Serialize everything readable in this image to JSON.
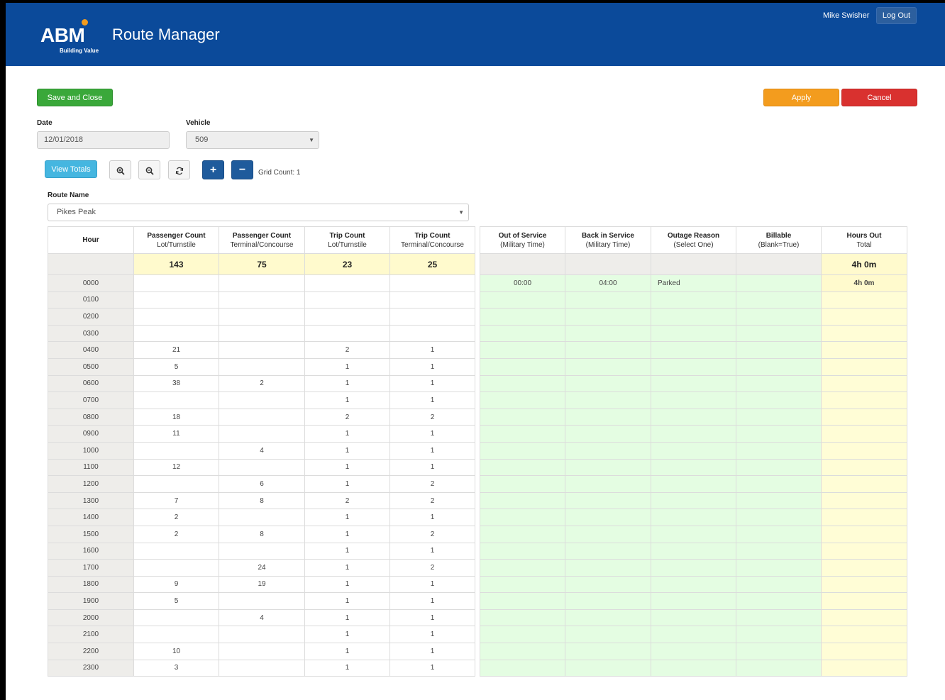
{
  "header": {
    "logo_text": "ABM",
    "logo_tagline": "Building Value",
    "app_title": "Route Manager",
    "user_name": "Mike Swisher",
    "logout_label": "Log Out",
    "brand_color": "#0b4a9a"
  },
  "toolbar": {
    "save_label": "Save and Close",
    "apply_label": "Apply",
    "cancel_label": "Cancel"
  },
  "form": {
    "date_label": "Date",
    "date_value": "12/01/2018",
    "vehicle_label": "Vehicle",
    "vehicle_value": "509",
    "route_label": "Route Name",
    "route_value": "Pikes Peak"
  },
  "grid_tools": {
    "view_totals_label": "View Totals",
    "zoom_in_icon": "zoom-in-icon",
    "zoom_out_icon": "zoom-out-icon",
    "refresh_icon": "refresh-icon",
    "add_icon": "plus-icon",
    "remove_icon": "minus-icon",
    "grid_count_text": "Grid Count: 1"
  },
  "counts_table": {
    "headers": [
      {
        "title": "Hour",
        "sub": ""
      },
      {
        "title": "Passenger Count",
        "sub": "Lot/Turnstile"
      },
      {
        "title": "Passenger Count",
        "sub": "Terminal/Concourse"
      },
      {
        "title": "Trip Count",
        "sub": "Lot/Turnstile"
      },
      {
        "title": "Trip Count",
        "sub": "Terminal/Concourse"
      }
    ],
    "totals": [
      "",
      "143",
      "75",
      "23",
      "25"
    ],
    "rows": [
      [
        "0000",
        "",
        "",
        "",
        ""
      ],
      [
        "0100",
        "",
        "",
        "",
        ""
      ],
      [
        "0200",
        "",
        "",
        "",
        ""
      ],
      [
        "0300",
        "",
        "",
        "",
        ""
      ],
      [
        "0400",
        "21",
        "",
        "2",
        "1"
      ],
      [
        "0500",
        "5",
        "",
        "1",
        "1"
      ],
      [
        "0600",
        "38",
        "2",
        "1",
        "1"
      ],
      [
        "0700",
        "",
        "",
        "1",
        "1"
      ],
      [
        "0800",
        "18",
        "",
        "2",
        "2"
      ],
      [
        "0900",
        "11",
        "",
        "1",
        "1"
      ],
      [
        "1000",
        "",
        "4",
        "1",
        "1"
      ],
      [
        "1100",
        "12",
        "",
        "1",
        "1"
      ],
      [
        "1200",
        "",
        "6",
        "1",
        "2"
      ],
      [
        "1300",
        "7",
        "8",
        "2",
        "2"
      ],
      [
        "1400",
        "2",
        "",
        "1",
        "1"
      ],
      [
        "1500",
        "2",
        "8",
        "1",
        "2"
      ],
      [
        "1600",
        "",
        "",
        "1",
        "1"
      ],
      [
        "1700",
        "",
        "24",
        "1",
        "2"
      ],
      [
        "1800",
        "9",
        "19",
        "1",
        "1"
      ],
      [
        "1900",
        "5",
        "",
        "1",
        "1"
      ],
      [
        "2000",
        "",
        "4",
        "1",
        "1"
      ],
      [
        "2100",
        "",
        "",
        "1",
        "1"
      ],
      [
        "2200",
        "10",
        "",
        "1",
        "1"
      ],
      [
        "2300",
        "3",
        "",
        "1",
        "1"
      ]
    ]
  },
  "outage_table": {
    "headers": [
      {
        "title": "Out of Service",
        "sub": "(Military Time)"
      },
      {
        "title": "Back in Service",
        "sub": "(Military Time)"
      },
      {
        "title": "Outage Reason",
        "sub": "(Select One)"
      },
      {
        "title": "Billable",
        "sub": "(Blank=True)"
      },
      {
        "title": "Hours Out",
        "sub": "Total"
      }
    ],
    "totals": [
      "",
      "",
      "",
      "",
      "4h 0m"
    ],
    "rows": [
      [
        "00:00",
        "04:00",
        "Parked",
        "",
        "4h 0m"
      ],
      [
        "",
        "",
        "",
        "",
        ""
      ],
      [
        "",
        "",
        "",
        "",
        ""
      ],
      [
        "",
        "",
        "",
        "",
        ""
      ],
      [
        "",
        "",
        "",
        "",
        ""
      ],
      [
        "",
        "",
        "",
        "",
        ""
      ],
      [
        "",
        "",
        "",
        "",
        ""
      ],
      [
        "",
        "",
        "",
        "",
        ""
      ],
      [
        "",
        "",
        "",
        "",
        ""
      ],
      [
        "",
        "",
        "",
        "",
        ""
      ],
      [
        "",
        "",
        "",
        "",
        ""
      ],
      [
        "",
        "",
        "",
        "",
        ""
      ],
      [
        "",
        "",
        "",
        "",
        ""
      ],
      [
        "",
        "",
        "",
        "",
        ""
      ],
      [
        "",
        "",
        "",
        "",
        ""
      ],
      [
        "",
        "",
        "",
        "",
        ""
      ],
      [
        "",
        "",
        "",
        "",
        ""
      ],
      [
        "",
        "",
        "",
        "",
        ""
      ],
      [
        "",
        "",
        "",
        "",
        ""
      ],
      [
        "",
        "",
        "",
        "",
        ""
      ],
      [
        "",
        "",
        "",
        "",
        ""
      ],
      [
        "",
        "",
        "",
        "",
        ""
      ],
      [
        "",
        "",
        "",
        "",
        ""
      ],
      [
        "",
        "",
        "",
        "",
        ""
      ]
    ]
  }
}
